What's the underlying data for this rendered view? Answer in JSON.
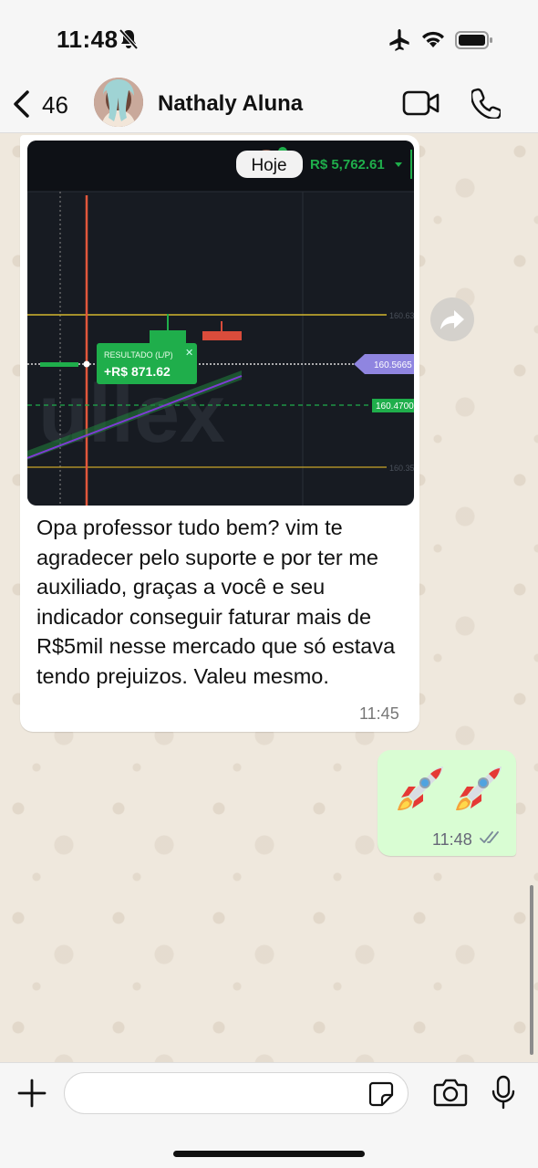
{
  "status_bar": {
    "time": "11:48"
  },
  "header": {
    "back_count": "46",
    "contact_name": "Nathaly Aluna"
  },
  "incoming_message": {
    "image": {
      "date_chip": "Hoje",
      "balance": "R$ 5,762.61",
      "result_label": "RESULTADO (L/P)",
      "result_value": "+R$ 871.62",
      "price_tags": [
        "160.5665",
        "160.4700"
      ],
      "axis_labels": [
        "160.63",
        "160.35"
      ],
      "watermark": "ullex"
    },
    "text": "Opa professor tudo bem? vim te agradecer pelo suporte    e por ter me auxiliado, graças a você e seu indicador conseguir faturar mais de R$5mil nesse mercado que só estava tendo prejuizos. Valeu mesmo.",
    "time": "11:45"
  },
  "outgoing_message": {
    "emojis": [
      "rocket",
      "rocket"
    ],
    "time": "11:48",
    "status": "read"
  },
  "colors": {
    "bubble_out": "#d9fdd3",
    "bubble_in": "#ffffff",
    "chart_bg": "#171b22",
    "green": "#1fae4b",
    "red": "#d94c3b",
    "purple": "#8f85e0"
  }
}
